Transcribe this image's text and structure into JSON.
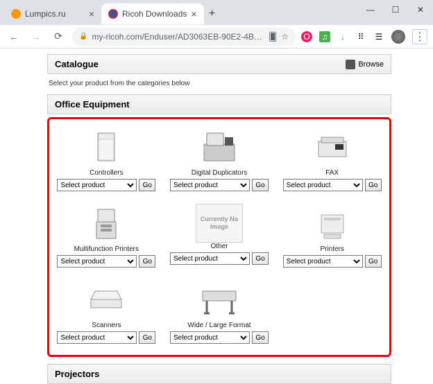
{
  "window": {
    "tabs": [
      {
        "title": "Lumpics.ru",
        "active": false
      },
      {
        "title": "Ricoh Downloads",
        "active": true
      }
    ],
    "newtab": "+",
    "controls": {
      "minimize": "—",
      "maximize": "☐",
      "close": "✕"
    }
  },
  "addressbar": {
    "back": "←",
    "forward": "→",
    "reload": "⟳",
    "url": "my-ricoh.com/Enduser/AD3063EB-90E2-4BC7-A6DC-ACB1547D9655/b…",
    "translate": "⭑",
    "star": "☆"
  },
  "page": {
    "catalogue": {
      "title": "Catalogue",
      "browse": "Browse"
    },
    "subtext": "Select your product from the categories below",
    "section1": "Office Equipment",
    "section2": "Projectors",
    "select_placeholder": "Select product",
    "go": "Go",
    "noimage": "Currently No Image",
    "categories": [
      {
        "name": "Controllers",
        "img": "controllers"
      },
      {
        "name": "Digital Duplicators",
        "img": "duplicator"
      },
      {
        "name": "FAX",
        "img": "fax"
      },
      {
        "name": "Multifunction Printers",
        "img": "mfp"
      },
      {
        "name": "Other",
        "img": "none"
      },
      {
        "name": "Printers",
        "img": "printer"
      },
      {
        "name": "Scanners",
        "img": "scanner"
      },
      {
        "name": "Wide / Large Format",
        "img": "wide"
      }
    ]
  }
}
